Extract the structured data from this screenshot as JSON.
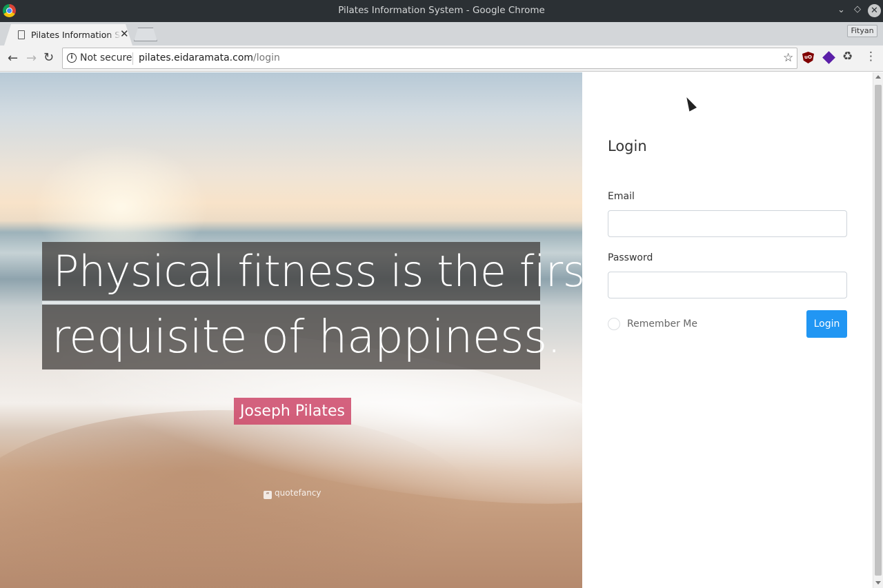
{
  "window": {
    "title": "Pilates Information System - Google Chrome",
    "controls": [
      "chevron-down-icon",
      "restore-icon",
      "close-icon"
    ]
  },
  "tabs": [
    {
      "title": "Pilates Information System",
      "active": true
    }
  ],
  "profile": {
    "name": "Fityan"
  },
  "toolbar": {
    "security_label": "Not secure",
    "url_host": "pilates.eidaramata.com",
    "url_path": "/login",
    "extensions": [
      "ublock-origin-icon",
      "purple-diamond-icon",
      "recycle-icon"
    ]
  },
  "hero": {
    "quote_line1": "Physical fitness is the first",
    "quote_line2": "requisite of happiness.",
    "author": "Joseph Pilates",
    "watermark": "quotefancy"
  },
  "login": {
    "title": "Login",
    "email_label": "Email",
    "email_value": "",
    "password_label": "Password",
    "password_value": "",
    "remember_label": "Remember Me",
    "remember_checked": false,
    "submit_label": "Login"
  },
  "colors": {
    "primary_button": "#2196f3",
    "author_badge": "#cd4669",
    "titlebar": "#2b3034"
  }
}
